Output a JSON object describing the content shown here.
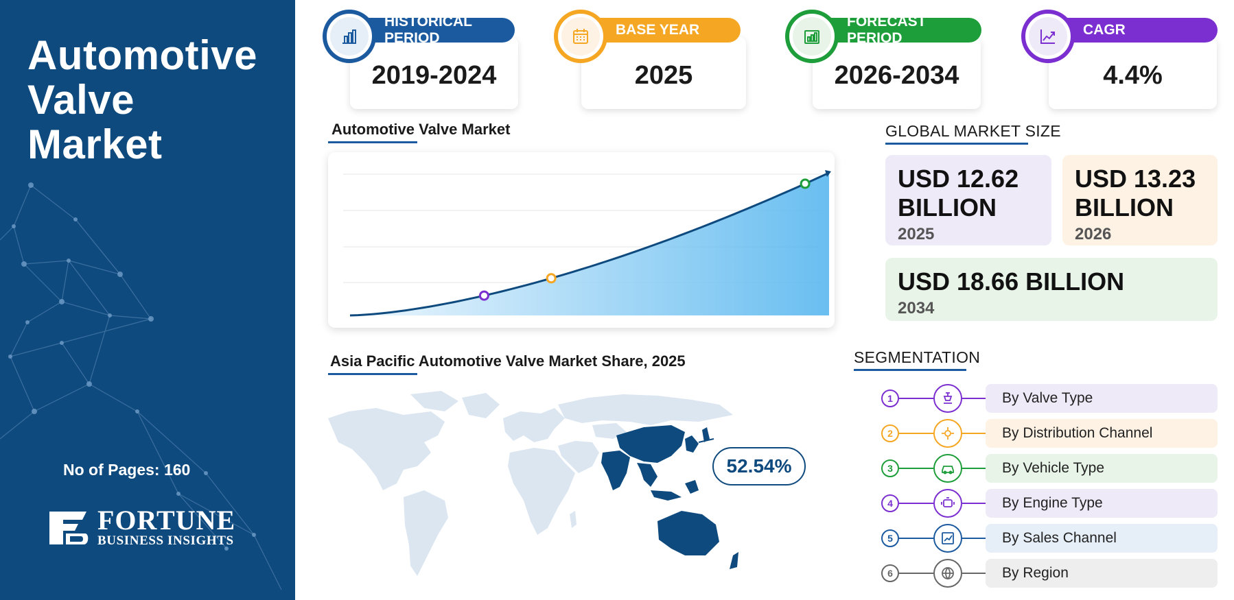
{
  "title": "Automotive Valve Market",
  "title_lines": [
    "Automotive",
    "Valve",
    "Market"
  ],
  "pages_text": "No of Pages: 160",
  "logo": {
    "line1": "FORTUNE",
    "line2": "BUSINESS INSIGHTS"
  },
  "stats": [
    {
      "label": "HISTORICAL PERIOD",
      "value": "2019-2024",
      "color": "#1c5aa0",
      "icon": "bar-chart-icon"
    },
    {
      "label": "BASE YEAR",
      "value": "2025",
      "color": "#f5a623",
      "icon": "calendar-icon"
    },
    {
      "label": "FORECAST PERIOD",
      "value": "2026-2034",
      "color": "#1e9e3a",
      "icon": "growth-chart-icon"
    },
    {
      "label": "CAGR",
      "value": "4.4%",
      "color": "#7b2fd0",
      "icon": "trend-up-icon"
    }
  ],
  "chart_title": "Automotive Valve Market",
  "chart_data": {
    "type": "area",
    "series": [
      {
        "values": [
          0,
          0.2,
          0.45,
          0.7,
          1.0
        ]
      }
    ],
    "highlight_points": [
      {
        "position": 0.28,
        "color": "#7b2fd0"
      },
      {
        "position": 0.42,
        "color": "#f5a623"
      },
      {
        "position": 0.95,
        "color": "#1e9e3a"
      }
    ],
    "grid": true
  },
  "global_title": "GLOBAL MARKET SIZE",
  "market_sizes": [
    {
      "amount": "USD 12.62 BILLION",
      "amount_l1": "USD 12.62",
      "amount_l2": "BILLION",
      "year": "2025",
      "bg": "#efeaf8"
    },
    {
      "amount": "USD 13.23 BILLION",
      "amount_l1": "USD 13.23",
      "amount_l2": "BILLION",
      "year": "2026",
      "bg": "#fdf2e4"
    },
    {
      "amount": "USD 18.66 BILLION",
      "year": "2034",
      "bg": "#e8f4e8"
    }
  ],
  "map_title": "Asia Pacific Automotive Valve Market Share, 2025",
  "map_share": "52.54%",
  "segmentation_title": "SEGMENTATION",
  "segments": [
    {
      "num": "1",
      "label": "By Valve Type",
      "color": "#7b2fd0",
      "bg": "#efeaf8",
      "icon": "valve-icon"
    },
    {
      "num": "2",
      "label": "By Distribution Channel",
      "color": "#f5a623",
      "bg": "#fdf2e4",
      "icon": "distribution-icon"
    },
    {
      "num": "3",
      "label": "By Vehicle Type",
      "color": "#1e9e3a",
      "bg": "#e8f4e8",
      "icon": "car-icon"
    },
    {
      "num": "4",
      "label": "By Engine Type",
      "color": "#7b2fd0",
      "bg": "#efeaf8",
      "icon": "engine-icon"
    },
    {
      "num": "5",
      "label": "By Sales Channel",
      "color": "#1c5aa0",
      "bg": "#e6eff8",
      "icon": "sales-chart-icon"
    },
    {
      "num": "6",
      "label": "By Region",
      "color": "#666666",
      "bg": "#eeeeee",
      "icon": "globe-icon"
    }
  ]
}
